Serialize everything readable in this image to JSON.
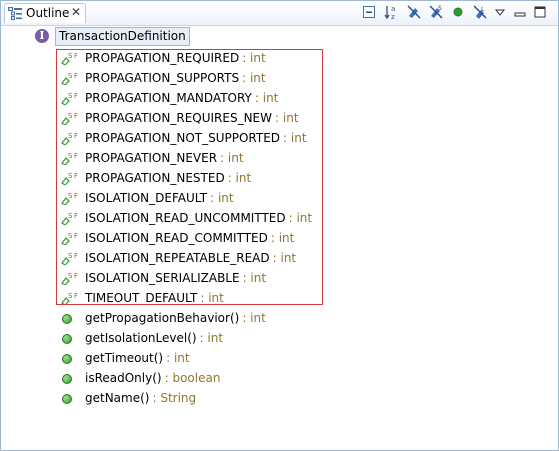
{
  "view": {
    "tab_title": "Outline",
    "toolbar": [
      {
        "name": "collapse-all-icon"
      },
      {
        "name": "sort-icon"
      },
      {
        "name": "hide-fields-icon"
      },
      {
        "name": "hide-static-icon"
      },
      {
        "name": "hide-nonpublic-icon"
      },
      {
        "name": "hide-local-types-icon"
      },
      {
        "name": "view-menu-icon"
      },
      {
        "name": "minimize-icon"
      },
      {
        "name": "maximize-icon"
      }
    ]
  },
  "outline": {
    "root": "TransactionDefinition",
    "fields": [
      {
        "name": "PROPAGATION_REQUIRED",
        "type": ": int"
      },
      {
        "name": "PROPAGATION_SUPPORTS",
        "type": ": int"
      },
      {
        "name": "PROPAGATION_MANDATORY",
        "type": ": int"
      },
      {
        "name": "PROPAGATION_REQUIRES_NEW",
        "type": ": int"
      },
      {
        "name": "PROPAGATION_NOT_SUPPORTED",
        "type": ": int"
      },
      {
        "name": "PROPAGATION_NEVER",
        "type": ": int"
      },
      {
        "name": "PROPAGATION_NESTED",
        "type": ": int"
      },
      {
        "name": "ISOLATION_DEFAULT",
        "type": ": int"
      },
      {
        "name": "ISOLATION_READ_UNCOMMITTED",
        "type": ": int"
      },
      {
        "name": "ISOLATION_READ_COMMITTED",
        "type": ": int"
      },
      {
        "name": "ISOLATION_REPEATABLE_READ",
        "type": ": int"
      },
      {
        "name": "ISOLATION_SERIALIZABLE",
        "type": ": int"
      },
      {
        "name": "TIMEOUT_DEFAULT",
        "type": ": int"
      }
    ],
    "methods": [
      {
        "name": "getPropagationBehavior()",
        "type": ": int"
      },
      {
        "name": "getIsolationLevel()",
        "type": ": int"
      },
      {
        "name": "getTimeout()",
        "type": ": int"
      },
      {
        "name": "isReadOnly()",
        "type": ": boolean"
      },
      {
        "name": "getName()",
        "type": ": String"
      }
    ]
  },
  "colors": {
    "type_text": "#94752d",
    "highlight": "#d33d3d",
    "interface_icon": "#7a5ea4",
    "method_icon": "#2f9a2f"
  }
}
